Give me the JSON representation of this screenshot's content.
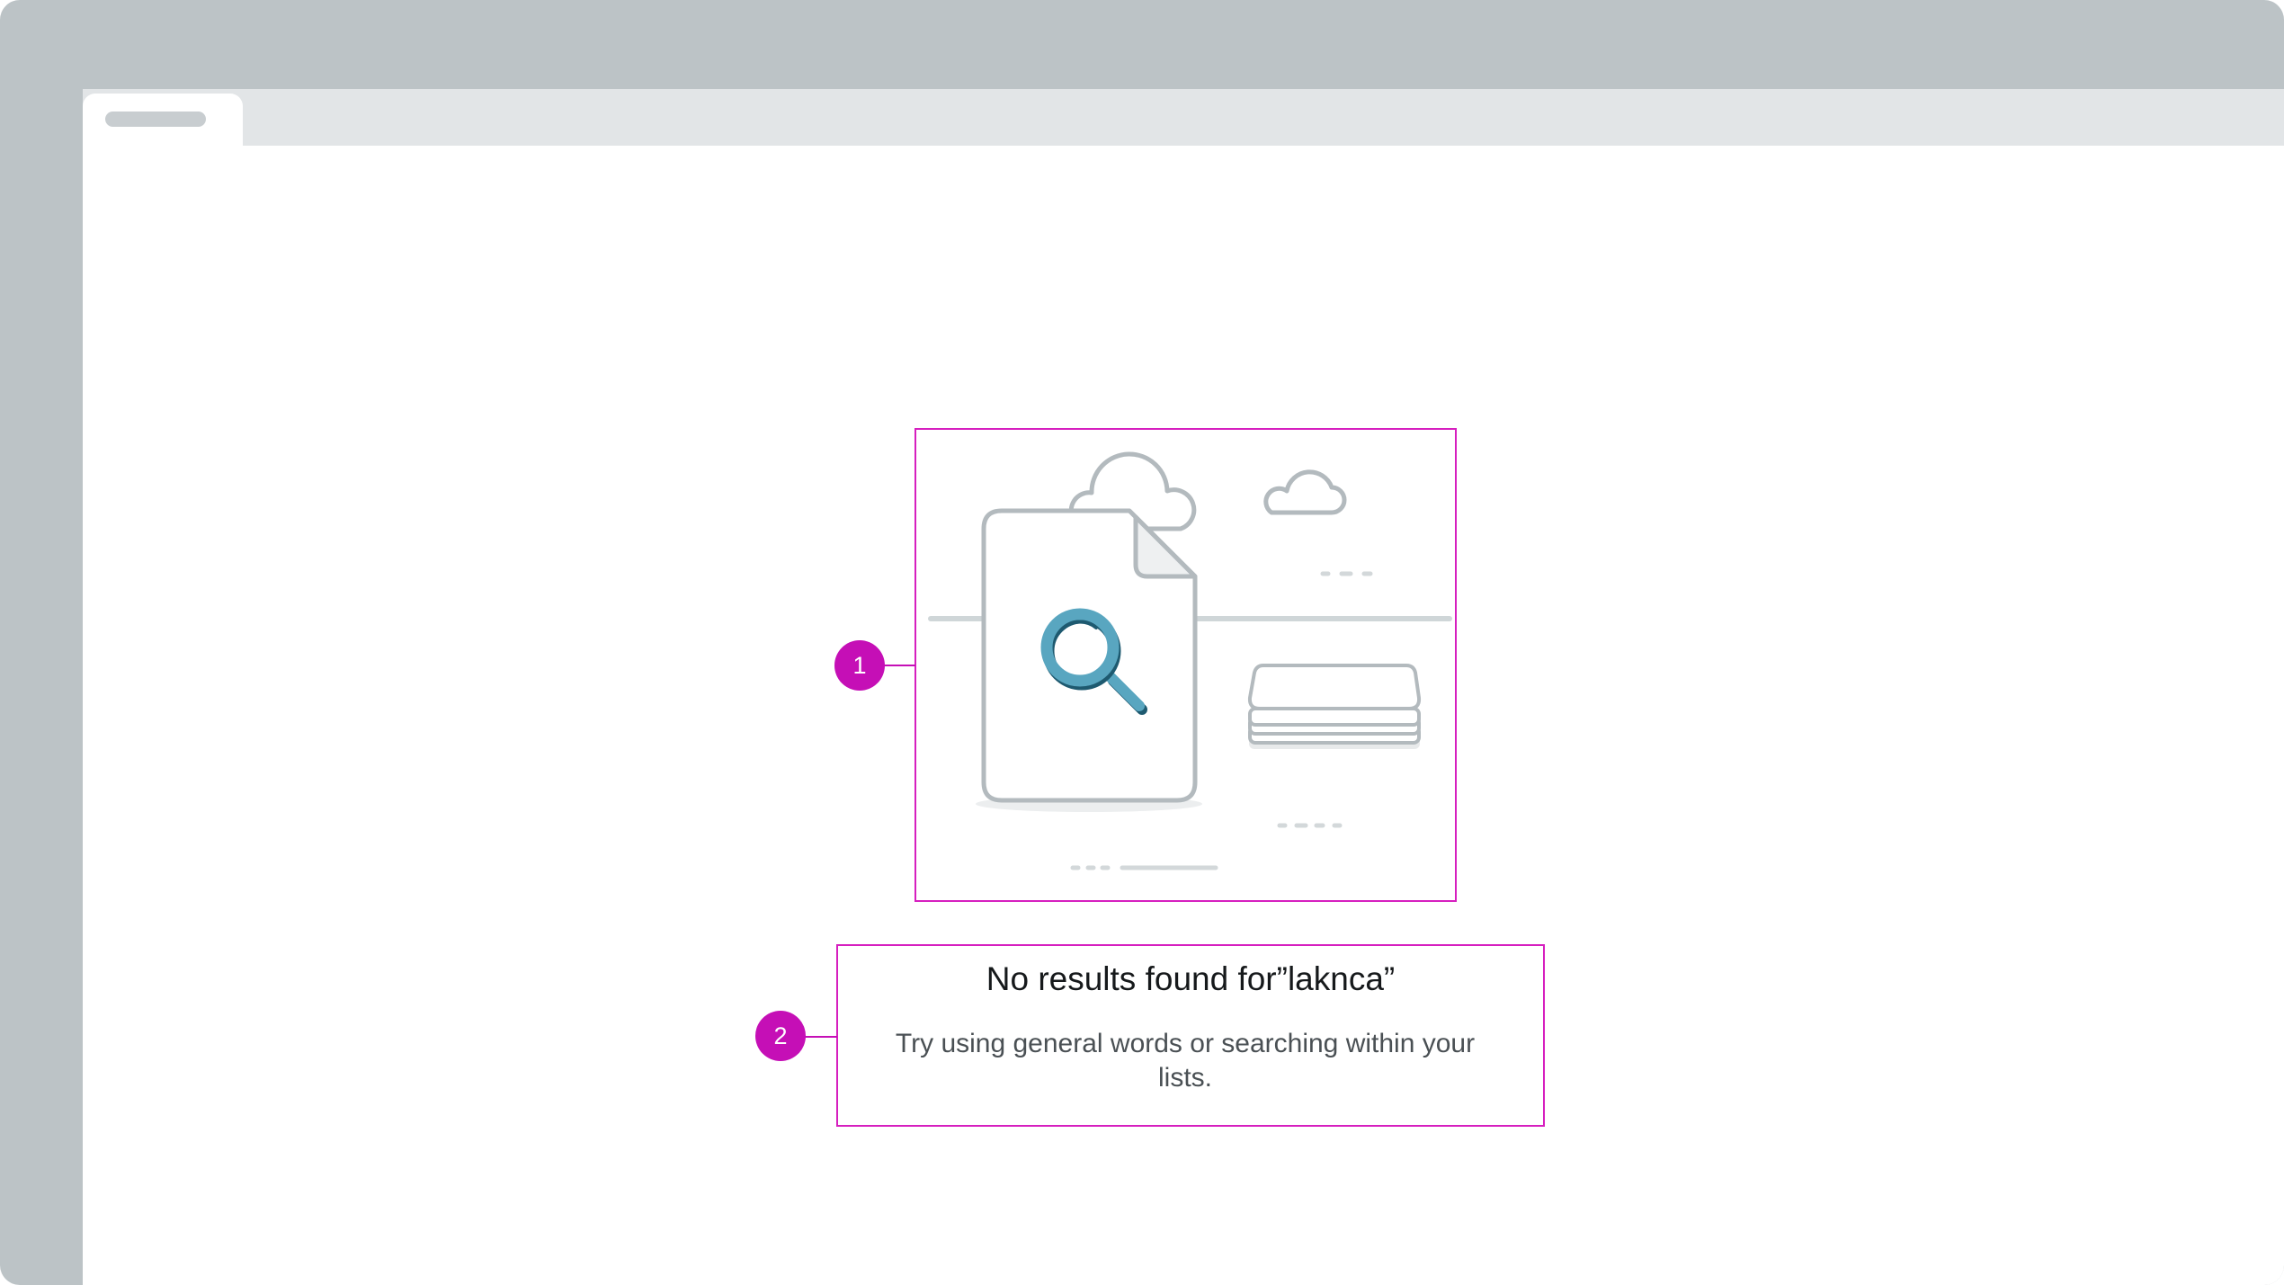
{
  "browser": {
    "active_tab": {
      "placeholder_icon": "tab-title-placeholder"
    }
  },
  "empty_state": {
    "illustration": {
      "icons": [
        "document-icon",
        "magnifier-icon",
        "cloud-icon",
        "stack-icon"
      ],
      "accent_color": "#59a6c0",
      "accent_dark_color": "#1e5a70"
    },
    "title": "No results found for”laknca”",
    "description": "Try using general words or searching within your lists."
  },
  "annotations": [
    {
      "number": "1"
    },
    {
      "number": "2"
    }
  ],
  "colors": {
    "annotation": "#c50fb6",
    "frame": "#bcc3c6",
    "tab_strip": "#e2e5e7"
  }
}
